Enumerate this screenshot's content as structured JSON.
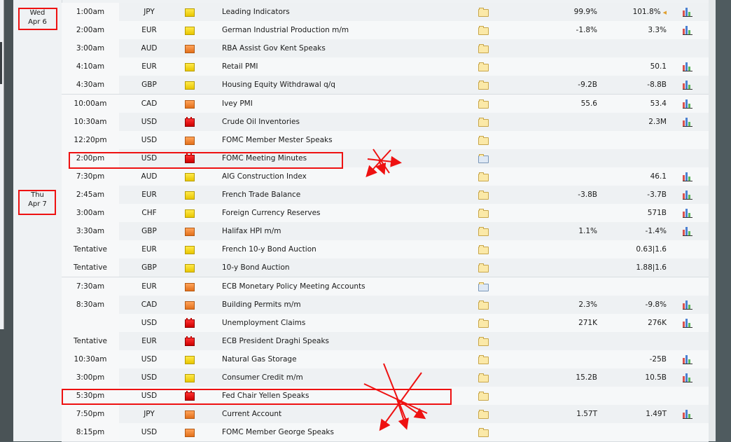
{
  "dates": [
    {
      "line1": "Wed",
      "line2": "Apr 6"
    },
    {
      "line1": "Thu",
      "line2": "Apr 7"
    }
  ],
  "impact_colors": {
    "low": "#f0d000",
    "medium": "#f08a30",
    "high": "#e00000"
  },
  "annotation_color": "#ee1111",
  "events": [
    {
      "time": "1:00am",
      "currency": "JPY",
      "impact": "low",
      "event": "Leading Indicators",
      "detail_icon": "folder-icon",
      "actual": "99.9%",
      "forecast": "101.8%",
      "forecast_flag": true,
      "chart": true
    },
    {
      "time": "2:00am",
      "currency": "EUR",
      "impact": "low",
      "event": "German Industrial Production m/m",
      "detail_icon": "folder-icon",
      "actual": "-1.8%",
      "forecast": "3.3%",
      "chart": true
    },
    {
      "time": "3:00am",
      "currency": "AUD",
      "impact": "medium",
      "event": "RBA Assist Gov Kent Speaks",
      "detail_icon": "folder-icon",
      "actual": "",
      "forecast": "",
      "chart": false
    },
    {
      "time": "4:10am",
      "currency": "EUR",
      "impact": "low",
      "event": "Retail PMI",
      "detail_icon": "folder-icon",
      "actual": "",
      "forecast": "50.1",
      "chart": true
    },
    {
      "time": "4:30am",
      "currency": "GBP",
      "impact": "low",
      "event": "Housing Equity Withdrawal q/q",
      "detail_icon": "folder-icon",
      "actual": "-9.2B",
      "forecast": "-8.8B",
      "chart": true
    },
    {
      "time": "10:00am",
      "currency": "CAD",
      "impact": "medium",
      "event": "Ivey PMI",
      "detail_icon": "folder-icon",
      "actual": "55.6",
      "forecast": "53.4",
      "chart": true
    },
    {
      "time": "10:30am",
      "currency": "USD",
      "impact": "high",
      "event": "Crude Oil Inventories",
      "detail_icon": "folder-icon",
      "actual": "",
      "forecast": "2.3M",
      "chart": true
    },
    {
      "time": "12:20pm",
      "currency": "USD",
      "impact": "medium",
      "event": "FOMC Member Mester Speaks",
      "detail_icon": "folder-icon",
      "actual": "",
      "forecast": "",
      "chart": false
    },
    {
      "time": "2:00pm",
      "currency": "USD",
      "impact": "high",
      "event": "FOMC Meeting Minutes",
      "detail_icon": "document-folder-icon",
      "actual": "",
      "forecast": "",
      "chart": false
    },
    {
      "time": "7:30pm",
      "currency": "AUD",
      "impact": "low",
      "event": "AIG Construction Index",
      "detail_icon": "folder-icon",
      "actual": "",
      "forecast": "46.1",
      "chart": true
    },
    {
      "time": "2:45am",
      "currency": "EUR",
      "impact": "low",
      "event": "French Trade Balance",
      "detail_icon": "folder-icon",
      "actual": "-3.8B",
      "forecast": "-3.7B",
      "chart": true
    },
    {
      "time": "3:00am",
      "currency": "CHF",
      "impact": "low",
      "event": "Foreign Currency Reserves",
      "detail_icon": "folder-icon",
      "actual": "",
      "forecast": "571B",
      "chart": true
    },
    {
      "time": "3:30am",
      "currency": "GBP",
      "impact": "medium",
      "event": "Halifax HPI m/m",
      "detail_icon": "folder-icon",
      "actual": "1.1%",
      "forecast": "-1.4%",
      "chart": true
    },
    {
      "time": "Tentative",
      "currency": "EUR",
      "impact": "low",
      "event": "French 10-y Bond Auction",
      "detail_icon": "folder-icon",
      "actual": "",
      "forecast": "0.63|1.6",
      "chart": false
    },
    {
      "time": "Tentative",
      "currency": "GBP",
      "impact": "low",
      "event": "10-y Bond Auction",
      "detail_icon": "folder-icon",
      "actual": "",
      "forecast": "1.88|1.6",
      "chart": false
    },
    {
      "time": "7:30am",
      "currency": "EUR",
      "impact": "medium",
      "event": "ECB Monetary Policy Meeting Accounts",
      "detail_icon": "document-folder-icon",
      "actual": "",
      "forecast": "",
      "chart": false
    },
    {
      "time": "8:30am",
      "currency": "CAD",
      "impact": "medium",
      "event": "Building Permits m/m",
      "detail_icon": "folder-icon",
      "actual": "2.3%",
      "forecast": "-9.8%",
      "chart": true
    },
    {
      "time": "",
      "currency": "USD",
      "impact": "high",
      "event": "Unemployment Claims",
      "detail_icon": "folder-icon",
      "actual": "271K",
      "forecast": "276K",
      "chart": true
    },
    {
      "time": "Tentative",
      "currency": "EUR",
      "impact": "high",
      "event": "ECB President Draghi Speaks",
      "detail_icon": "folder-icon",
      "actual": "",
      "forecast": "",
      "chart": false
    },
    {
      "time": "10:30am",
      "currency": "USD",
      "impact": "low",
      "event": "Natural Gas Storage",
      "detail_icon": "folder-icon",
      "actual": "",
      "forecast": "-25B",
      "chart": true
    },
    {
      "time": "3:00pm",
      "currency": "USD",
      "impact": "low",
      "event": "Consumer Credit m/m",
      "detail_icon": "folder-icon",
      "actual": "15.2B",
      "forecast": "10.5B",
      "chart": true
    },
    {
      "time": "5:30pm",
      "currency": "USD",
      "impact": "high",
      "event": "Fed Chair Yellen Speaks",
      "detail_icon": "folder-icon",
      "actual": "",
      "forecast": "",
      "chart": false
    },
    {
      "time": "7:50pm",
      "currency": "JPY",
      "impact": "medium",
      "event": "Current Account",
      "detail_icon": "folder-icon",
      "actual": "1.57T",
      "forecast": "1.49T",
      "chart": true
    },
    {
      "time": "8:15pm",
      "currency": "USD",
      "impact": "medium",
      "event": "FOMC Member George Speaks",
      "detail_icon": "folder-icon",
      "actual": "",
      "forecast": "",
      "chart": false
    }
  ]
}
